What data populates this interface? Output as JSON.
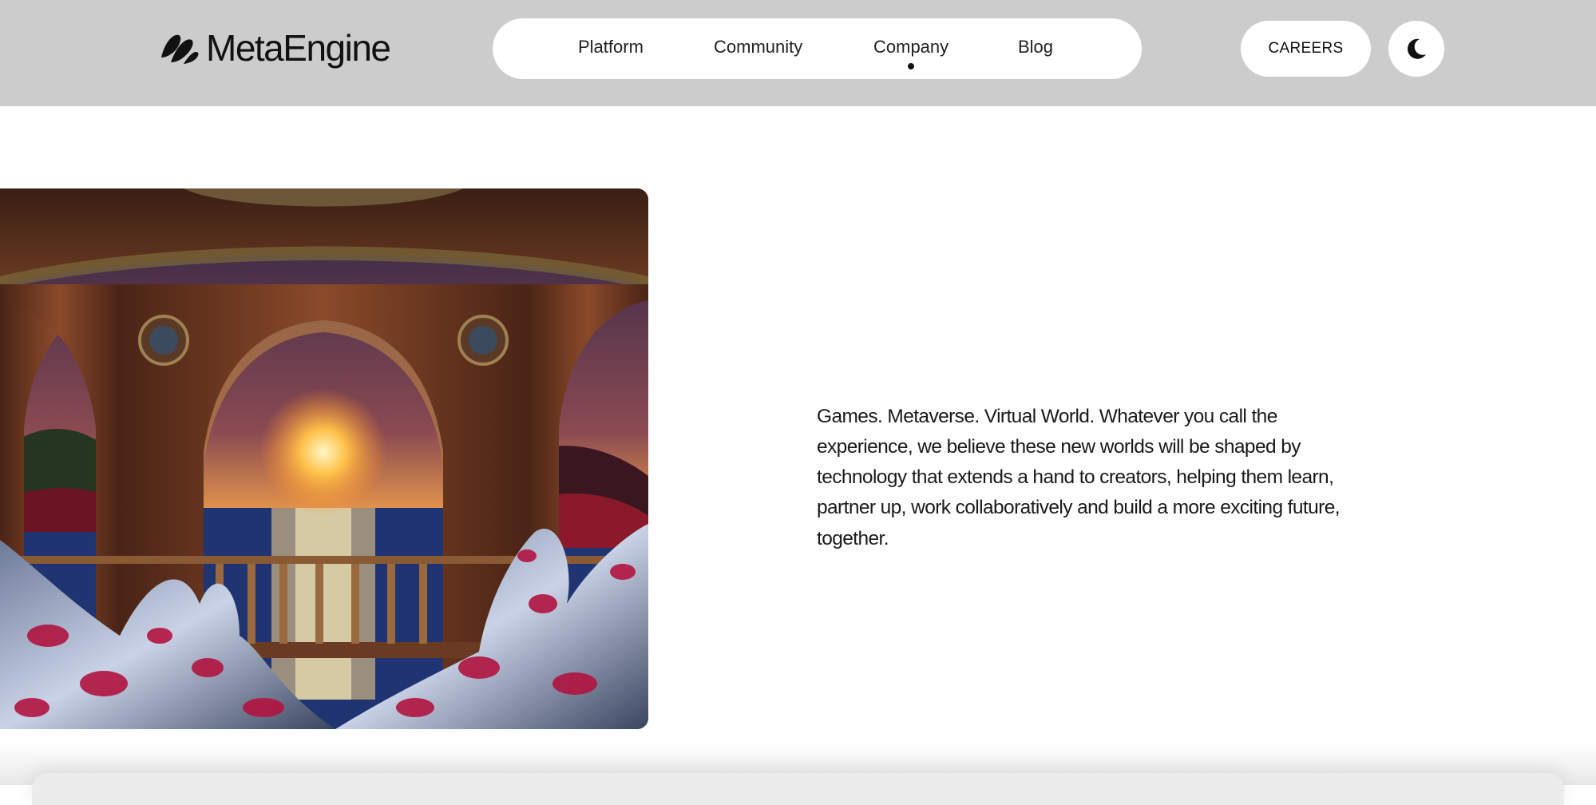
{
  "brand": {
    "name": "MetaEngine",
    "logo_icon": "double-leaf-mark"
  },
  "nav": {
    "items": [
      {
        "label": "Platform",
        "active": false
      },
      {
        "label": "Community",
        "active": false
      },
      {
        "label": "Company",
        "active": true
      },
      {
        "label": "Blog",
        "active": false
      }
    ]
  },
  "header_actions": {
    "careers_label": "CAREERS",
    "theme_toggle_icon": "moon-icon"
  },
  "hero": {
    "image_subject": "ornate gazebo arches framing a sunset over water, with glossy spotted hands in the foreground",
    "text": "Games. Metaverse. Virtual World. Whatever you call the experience, we believe these new worlds will be shaped by technology that extends a hand to creators, helping them learn, partner up, work collaboratively and build a more exciting future, together."
  },
  "colors": {
    "header_bg": "#cccccc",
    "pill_bg": "#ffffff",
    "text": "#111111",
    "page_bg": "#ffffff"
  }
}
